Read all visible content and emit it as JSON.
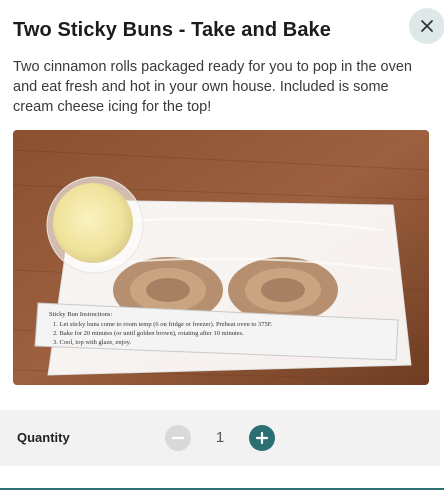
{
  "product": {
    "title": "Two Sticky Buns - Take and Bake",
    "description": "Two cinnamon rolls packaged ready for you to pop in the oven and eat fresh and hot in your own house. Included is some cream cheese icing for the top!",
    "image_label_lines": [
      "Sticky Bun Instructions:",
      "1.  Let sticky buns come to room temp (6 on fridge or freezer). Preheat oven to 375F.",
      "2.  Bake for 20 minutes (or until golden brown), rotating after 10 minutes.",
      "3.  Cool, top with glaze, enjoy."
    ]
  },
  "quantity": {
    "label": "Quantity",
    "value": "1"
  },
  "icons": {
    "close": "close-icon",
    "minus": "minus-icon",
    "plus": "plus-icon"
  },
  "colors": {
    "accent": "#2b6f73",
    "close_bg": "#dfe8e9",
    "minus_disabled": "#d9d9d9",
    "qty_bar_bg": "#f2f2f2"
  }
}
